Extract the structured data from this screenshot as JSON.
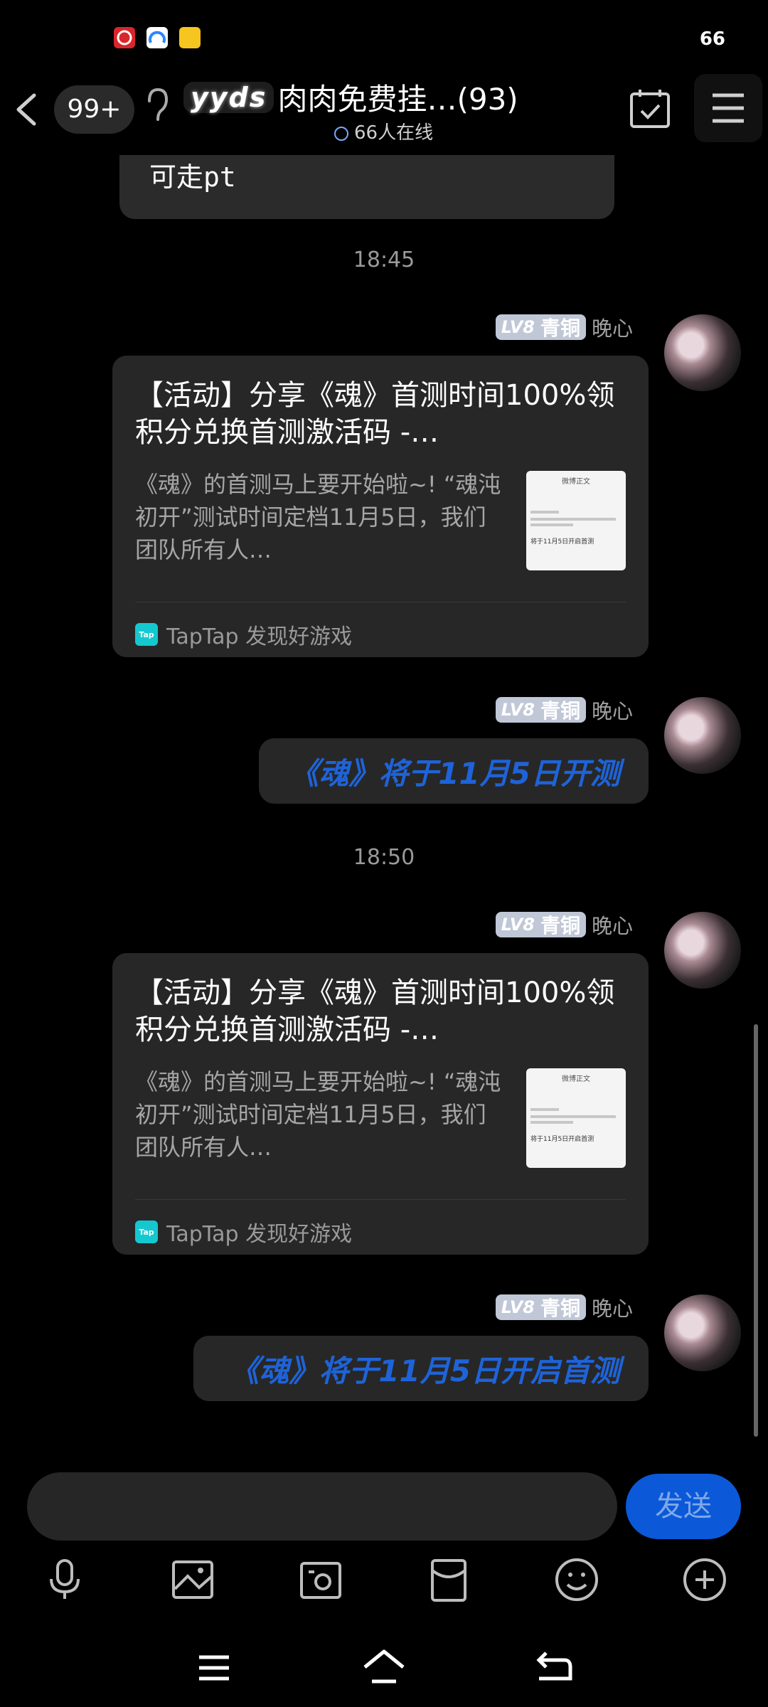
{
  "status_bar": {
    "battery": "66",
    "apps": [
      {
        "icon": "netease-music-icon",
        "color": "#d8262b"
      },
      {
        "icon": "browser-icon",
        "color": "#2a88ff"
      },
      {
        "icon": "meituan-icon",
        "color": "#f7c520"
      }
    ]
  },
  "header": {
    "unread_badge": "99+",
    "group_logo_text": "yyds",
    "group_title": "肉肉免费挂…(93)",
    "online_text": "66人在线"
  },
  "chat": {
    "previous_message_fragment": "可走pt",
    "messages": [
      {
        "type": "time",
        "text": "18:45"
      },
      {
        "type": "card",
        "sender": {
          "level": "LV8",
          "rank": "青铜",
          "name": "晚心"
        },
        "title": "【活动】分享《魂》首测时间100%领积分兑换首测激活码 -…",
        "description": "《魂》的首测马上要开始啦~! “魂沌初开”测试时间定档11月5日，我们团队所有人…",
        "source": "TapTap 发现好游戏",
        "thumb_header": "微博正文",
        "thumb_snippet": "将于11月5日开启首测"
      },
      {
        "type": "text",
        "sender": {
          "level": "LV8",
          "rank": "青铜",
          "name": "晚心"
        },
        "text": "《魂》将于11月5日开测"
      },
      {
        "type": "time",
        "text": "18:50"
      },
      {
        "type": "card",
        "sender": {
          "level": "LV8",
          "rank": "青铜",
          "name": "晚心"
        },
        "title": "【活动】分享《魂》首测时间100%领积分兑换首测激活码 -…",
        "description": "《魂》的首测马上要开始啦~! “魂沌初开”测试时间定档11月5日，我们团队所有人…",
        "source": "TapTap 发现好游戏",
        "thumb_header": "微博正文",
        "thumb_snippet": "将于11月5日开启首测"
      },
      {
        "type": "text",
        "sender": {
          "level": "LV8",
          "rank": "青铜",
          "name": "晚心"
        },
        "text": "《魂》将于11月5日开启首测"
      }
    ]
  },
  "input": {
    "placeholder": "",
    "send_label": "发送"
  },
  "toolbar": {
    "items": [
      "voice-icon",
      "image-icon",
      "camera-icon",
      "red-packet-icon",
      "emoji-icon",
      "more-icon"
    ]
  },
  "nav": {
    "items": [
      "menu-icon",
      "home-icon",
      "back-nav-icon"
    ]
  },
  "colors": {
    "background": "#000000",
    "bubble": "#272727",
    "accent_blue": "#1e63d8",
    "send_button": "#0b59d9",
    "level_badge": "#c0c7d6"
  }
}
